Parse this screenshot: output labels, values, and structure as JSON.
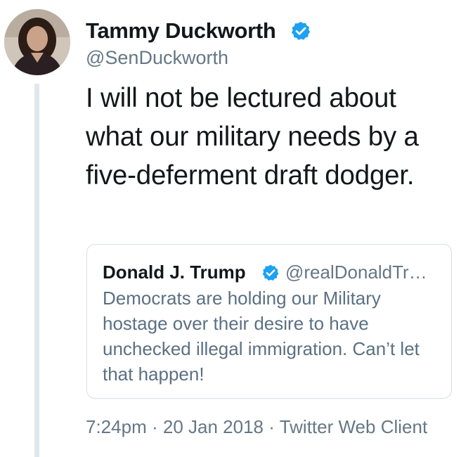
{
  "author": {
    "name": "Tammy Duckworth",
    "handle": "@SenDuckworth",
    "verified": true,
    "avatar_icon": "profile-photo"
  },
  "tweet": {
    "text": "I will not be lectured about what our military needs by a five-deferment draft dodger."
  },
  "quoted_tweet": {
    "name": "Donald J. Trump",
    "handle": "@realDonaldTr…",
    "verified": true,
    "text": "Democrats are holding our Military hostage over their desire to have unchecked illegal immigration. Can’t let that happen!"
  },
  "meta": {
    "time": "7:24pm",
    "separator": "·",
    "date": "20 Jan 2018",
    "client": "Twitter Web Client"
  },
  "colors": {
    "verified": "#1da1f2",
    "primary_text": "#14171a",
    "secondary_text": "#657786",
    "border": "#d8dee3",
    "thread_line": "#e1e8ed"
  }
}
